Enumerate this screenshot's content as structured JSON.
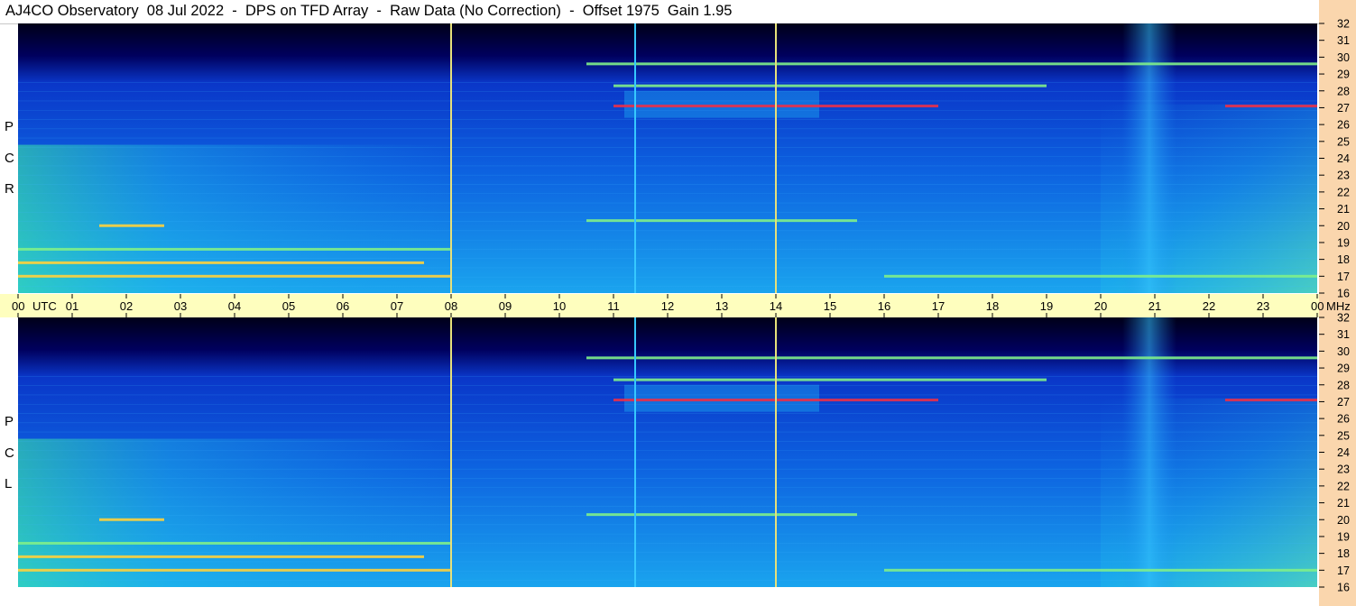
{
  "header": {
    "title": "AJ4CO Observatory  08 Jul 2022  -  DPS on TFD Array  -  Raw Data (No Correction)  -  Offset 1975  Gain 1.95"
  },
  "panels": [
    {
      "id": "rcp",
      "letters": [
        "R",
        "C",
        "P"
      ]
    },
    {
      "id": "lcp",
      "letters": [
        "L",
        "C",
        "P"
      ]
    }
  ],
  "colors": {
    "background_deep": "#00006a",
    "background_mid": "#0b55dc",
    "background_light": "#1fa8f0",
    "marker_line": "#e6e07a",
    "band_bright": "#ffd23c",
    "band_hot": "#e8304a",
    "band_green": "#7ff08a",
    "utc_band": "#fefebe",
    "right_strip": "#fad6ad"
  },
  "chart_data": {
    "type": "heatmap",
    "title": "AJ4CO Observatory  08 Jul 2022  -  DPS on TFD Array  -  Raw Data (No Correction)  -  Offset 1975  Gain 1.95",
    "x_axis": {
      "unit_label_start": "UTC",
      "tick_labels": [
        "00",
        "01",
        "02",
        "03",
        "04",
        "05",
        "06",
        "07",
        "08",
        "09",
        "10",
        "11",
        "12",
        "13",
        "14",
        "15",
        "16",
        "17",
        "18",
        "19",
        "20",
        "21",
        "22",
        "23",
        "00"
      ],
      "range_hours": [
        0,
        24
      ]
    },
    "y_axis": {
      "unit_label": "MHz",
      "tick_labels": [
        "32",
        "31",
        "30",
        "29",
        "28",
        "27",
        "26",
        "25",
        "24",
        "23",
        "22",
        "21",
        "20",
        "19",
        "18",
        "17",
        "16"
      ],
      "range_mhz": [
        16,
        32
      ]
    },
    "marker_lines_utc": [
      8.0,
      11.4,
      14.0
    ],
    "series": [
      {
        "name": "RCP",
        "horizontal_bands_mhz": [
          {
            "f": 27.1,
            "t_start": 11.0,
            "t_end": 17.0,
            "intensity": 0.95
          },
          {
            "f": 27.1,
            "t_start": 22.3,
            "t_end": 24.0,
            "intensity": 0.9
          },
          {
            "f": 17.0,
            "t_start": 0.0,
            "t_end": 8.0,
            "intensity": 0.85
          },
          {
            "f": 17.0,
            "t_start": 16.0,
            "t_end": 24.0,
            "intensity": 0.7
          },
          {
            "f": 17.8,
            "t_start": 0.0,
            "t_end": 7.5,
            "intensity": 0.8
          },
          {
            "f": 20.0,
            "t_start": 1.5,
            "t_end": 2.7,
            "intensity": 0.85
          },
          {
            "f": 20.3,
            "t_start": 10.5,
            "t_end": 15.5,
            "intensity": 0.7
          },
          {
            "f": 18.6,
            "t_start": 0.0,
            "t_end": 8.0,
            "intensity": 0.6
          },
          {
            "f": 29.6,
            "t_start": 10.5,
            "t_end": 24.0,
            "intensity": 0.55
          },
          {
            "f": 28.3,
            "t_start": 11.0,
            "t_end": 19.0,
            "intensity": 0.5
          }
        ]
      },
      {
        "name": "LCP",
        "horizontal_bands_mhz": [
          {
            "f": 27.1,
            "t_start": 11.0,
            "t_end": 17.0,
            "intensity": 0.95
          },
          {
            "f": 27.1,
            "t_start": 22.3,
            "t_end": 24.0,
            "intensity": 0.9
          },
          {
            "f": 17.0,
            "t_start": 0.0,
            "t_end": 8.0,
            "intensity": 0.85
          },
          {
            "f": 17.0,
            "t_start": 16.0,
            "t_end": 24.0,
            "intensity": 0.7
          },
          {
            "f": 17.8,
            "t_start": 0.0,
            "t_end": 7.5,
            "intensity": 0.8
          },
          {
            "f": 20.0,
            "t_start": 1.5,
            "t_end": 2.7,
            "intensity": 0.85
          },
          {
            "f": 20.3,
            "t_start": 10.5,
            "t_end": 15.5,
            "intensity": 0.7
          },
          {
            "f": 18.6,
            "t_start": 0.0,
            "t_end": 8.0,
            "intensity": 0.6
          },
          {
            "f": 29.6,
            "t_start": 10.5,
            "t_end": 24.0,
            "intensity": 0.55
          },
          {
            "f": 28.3,
            "t_start": 11.0,
            "t_end": 19.0,
            "intensity": 0.5
          }
        ]
      }
    ],
    "grid": false,
    "legend": "none"
  }
}
